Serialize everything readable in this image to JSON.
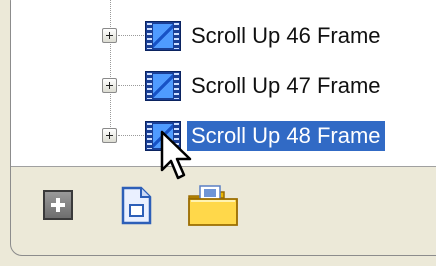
{
  "tree": {
    "items": [
      {
        "label": "Scroll Up 46 Frame",
        "selected": false
      },
      {
        "label": "Scroll Up 47 Frame",
        "selected": false
      },
      {
        "label": "Scroll Up 48 Frame",
        "selected": true
      }
    ]
  },
  "colors": {
    "selection": "#316ac5",
    "panel_bg": "#ece9d8",
    "tree_bg": "#ffffff"
  },
  "toolbar": {
    "icons": [
      "add-frame-icon",
      "new-page-icon",
      "open-folder-icon"
    ]
  }
}
